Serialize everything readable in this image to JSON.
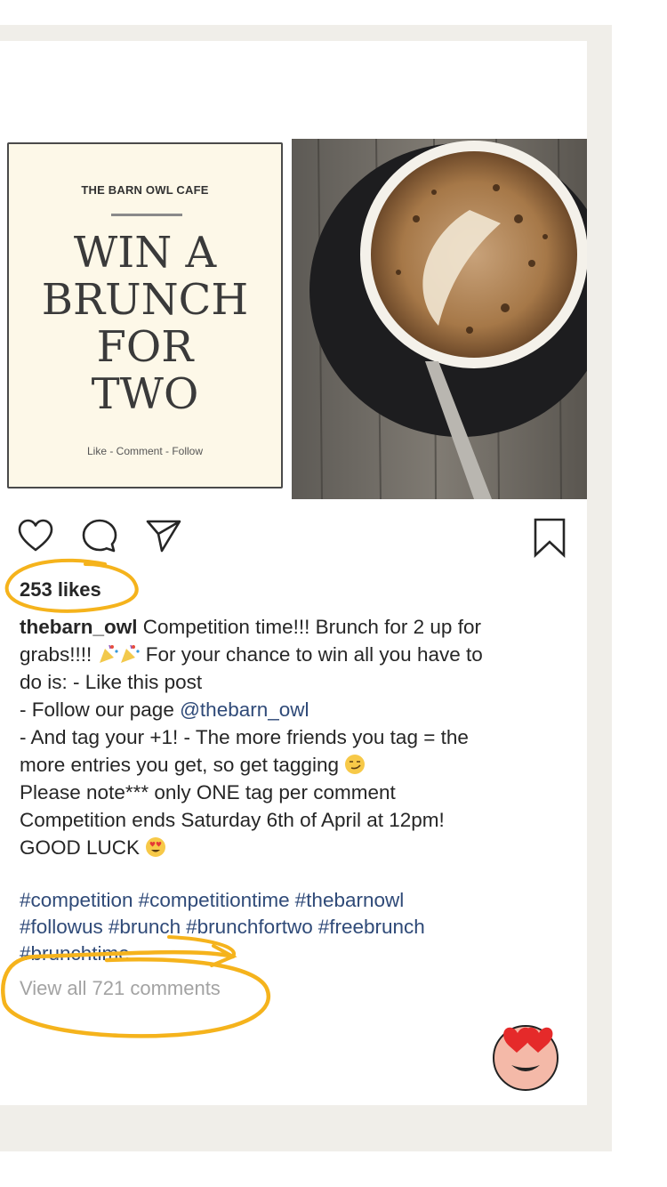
{
  "post": {
    "image": {
      "cafe_name": "THE BARN OWL CAFE",
      "headline": [
        "WIN A",
        "BRUNCH",
        "FOR",
        "TWO"
      ],
      "cta": "Like - Comment - Follow"
    },
    "actions": {
      "like_icon": "heart-icon",
      "comment_icon": "comment-bubble-icon",
      "share_icon": "paper-plane-icon",
      "save_icon": "bookmark-icon"
    },
    "likes_text": "253 likes",
    "caption": {
      "username": "thebarn_owl",
      "line1_rest": " Competition time!!! Brunch for 2 up for",
      "line2a": "grabs!!!! ",
      "line2b": " For your chance to win all you have to",
      "line3": "do is: - Like this post",
      "line4a": "- Follow our page ",
      "line4_mention": "@thebarn_owl",
      "line5": "- And tag your +1! - The more friends you tag = the",
      "line6": "more entries you get, so get tagging ",
      "line7": "Please note*** only ONE tag per comment",
      "line8": "Competition ends Saturday 6th of April at 12pm!",
      "line9": "GOOD LUCK "
    },
    "hashtags_line1": [
      "#competition",
      "#competitiontime",
      "#thebarnowl"
    ],
    "hashtags_line2": [
      "#followus",
      "#brunch",
      "#brunchfortwo",
      "#freebrunch"
    ],
    "hashtags_line3": [
      "#brunchtime"
    ],
    "view_comments": "View all 721 comments"
  },
  "colors": {
    "annotation": "#f5b31c",
    "link": "#2f4a78",
    "muted": "#a3a3a3"
  }
}
